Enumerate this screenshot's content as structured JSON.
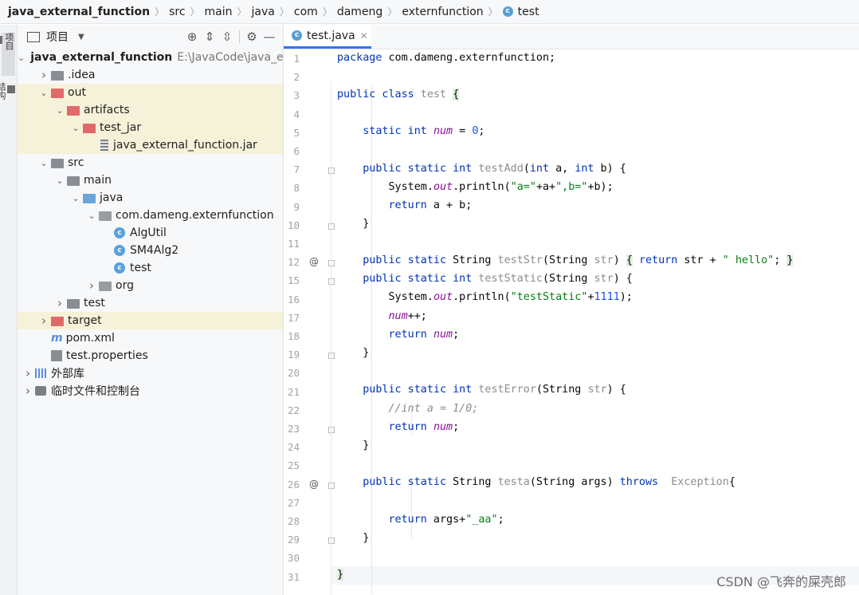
{
  "breadcrumb": [
    "java_external_function",
    "src",
    "main",
    "java",
    "com",
    "dameng",
    "externfunction",
    "test"
  ],
  "toolstrip": {
    "project_tab": "项目",
    "structure_tab": "结构"
  },
  "project_panel": {
    "title": "项目"
  },
  "tree": [
    {
      "label": "java_external_function",
      "extra": "E:\\JavaCode\\java_ext",
      "icon": "module-folder-icon",
      "indent": 0,
      "expanded": true,
      "bold": true
    },
    {
      "label": ".idea",
      "icon": "folder-icon",
      "indent": 1,
      "expanded": false
    },
    {
      "label": "out",
      "icon": "excluded-folder-icon",
      "indent": 1,
      "expanded": true,
      "highlight": true
    },
    {
      "label": "artifacts",
      "icon": "excluded-folder-icon",
      "indent": 2,
      "expanded": true,
      "highlight": true
    },
    {
      "label": "test_jar",
      "icon": "excluded-folder-icon",
      "indent": 3,
      "expanded": true,
      "highlight": true
    },
    {
      "label": "java_external_function.jar",
      "icon": "jar-icon",
      "indent": 4,
      "highlight": true
    },
    {
      "label": "src",
      "icon": "folder-icon",
      "indent": 1,
      "expanded": true
    },
    {
      "label": "main",
      "icon": "folder-icon",
      "indent": 2,
      "expanded": true
    },
    {
      "label": "java",
      "icon": "source-folder-icon",
      "indent": 3,
      "expanded": true
    },
    {
      "label": "com.dameng.externfunction",
      "icon": "package-icon",
      "indent": 4,
      "expanded": true
    },
    {
      "label": "AlgUtil",
      "icon": "class-icon",
      "indent": 5
    },
    {
      "label": "SM4Alg2",
      "icon": "class-icon",
      "indent": 5
    },
    {
      "label": "test",
      "icon": "class-icon",
      "indent": 5
    },
    {
      "label": "org",
      "icon": "package-icon",
      "indent": 4,
      "expanded": false
    },
    {
      "label": "test",
      "icon": "folder-icon",
      "indent": 2,
      "expanded": false
    },
    {
      "label": "target",
      "icon": "excluded-folder-icon",
      "indent": 1,
      "expanded": false,
      "highlight": true
    },
    {
      "label": "pom.xml",
      "icon": "maven-icon",
      "indent": 1
    },
    {
      "label": "test.properties",
      "icon": "properties-icon",
      "indent": 1
    },
    {
      "label": "外部库",
      "icon": "libraries-icon",
      "indent": 0,
      "expanded": false
    },
    {
      "label": "临时文件和控制台",
      "icon": "scratches-icon",
      "indent": 0,
      "expanded": false
    }
  ],
  "editor": {
    "tab_label": "test.java",
    "line_numbers": [
      "1",
      "2",
      "3",
      "4",
      "5",
      "6",
      "7",
      "8",
      "9",
      "10",
      "11",
      "12",
      "15",
      "16",
      "17",
      "18",
      "19",
      "20",
      "21",
      "22",
      "23",
      "24",
      "25",
      "26",
      "27",
      "28",
      "29",
      "30",
      "31"
    ]
  },
  "watermark": "CSDN @飞奔的屎壳郎"
}
